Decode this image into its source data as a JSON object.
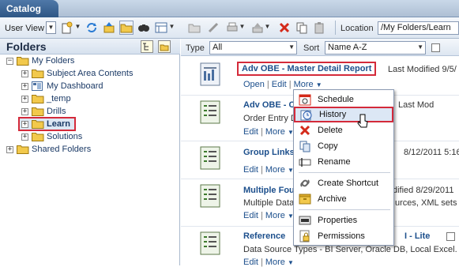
{
  "app": {
    "tab_label": "Catalog"
  },
  "toolbar": {
    "user_view_label": "User View",
    "location_label": "Location",
    "location_value": "/My Folders/Learn"
  },
  "folders_pane": {
    "title": "Folders",
    "tree": [
      {
        "label": "My Folders",
        "expander": "⊟"
      },
      {
        "label": "Subject Area Contents",
        "expander": "+"
      },
      {
        "label": "My Dashboard",
        "expander": "+"
      },
      {
        "label": "_temp",
        "expander": "+"
      },
      {
        "label": "Drills",
        "expander": "+"
      },
      {
        "label": "Learn",
        "expander": "+",
        "selected": true
      },
      {
        "label": "Solutions",
        "expander": "+"
      },
      {
        "label": "Shared Folders",
        "expander": "+"
      }
    ]
  },
  "filter": {
    "type_label": "Type",
    "type_value": "All",
    "sort_label": "Sort",
    "sort_value": "Name A-Z"
  },
  "items": [
    {
      "title": "Adv OBE - Master Detail Report",
      "meta": "Last Modified 9/5/",
      "sub": "",
      "actions": [
        "Open",
        "Edit",
        "More"
      ]
    },
    {
      "title": "Adv OBE - C",
      "meta": "Last Mod",
      "sub": "Order Entry D",
      "actions": [
        "Edit",
        "More"
      ]
    },
    {
      "title": "Group Links",
      "meta": "8/12/2011 5:16",
      "sub": "",
      "actions": [
        "Edit",
        "More"
      ]
    },
    {
      "title": "Multiple Fou",
      "meta": "dified 8/29/2011",
      "sub": "Multiple Data",
      "sub_tail": "urces, XML sets",
      "actions": [
        "Edit",
        "More"
      ]
    },
    {
      "title": "Reference",
      "meta": "I - Lite",
      "sub": "Data Source Types - BI Server, Oracle DB, Local Excel. D",
      "actions": [
        "Edit",
        "More"
      ]
    }
  ],
  "context_menu": {
    "items": [
      {
        "label": "Schedule",
        "icon": "schedule-icon"
      },
      {
        "label": "History",
        "icon": "history-icon",
        "highlighted": true
      },
      {
        "label": "Delete",
        "icon": "delete-icon"
      },
      {
        "label": "Copy",
        "icon": "copy-icon"
      },
      {
        "label": "Rename",
        "icon": "rename-icon"
      },
      {
        "label": "Create Shortcut",
        "icon": "shortcut-icon"
      },
      {
        "label": "Archive",
        "icon": "archive-icon"
      },
      {
        "label": "Properties",
        "icon": "properties-icon"
      },
      {
        "label": "Permissions",
        "icon": "permissions-icon"
      }
    ]
  },
  "colors": {
    "accent": "#1c4f8c",
    "highlight_border": "#d42a3a",
    "tab_bg": "#2f5785",
    "folder_yellow": "#f2c94c"
  }
}
